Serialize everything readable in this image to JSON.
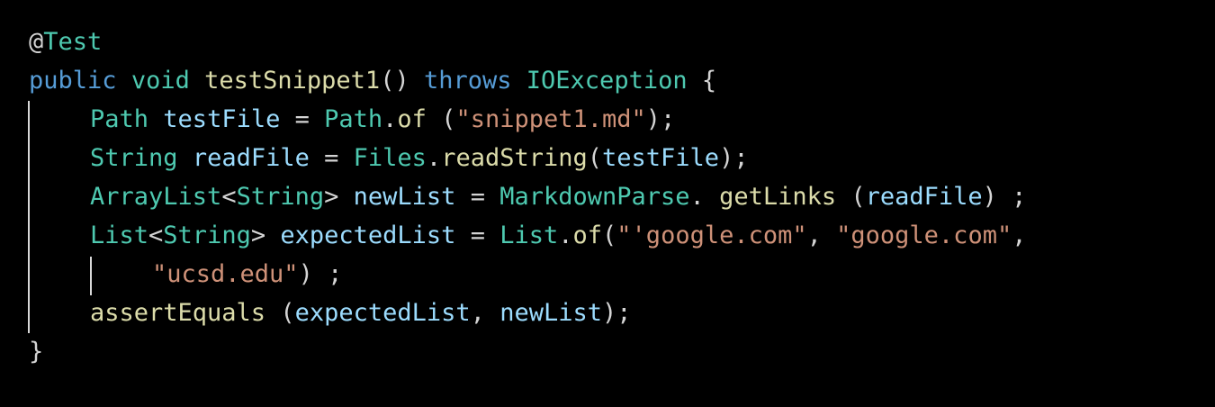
{
  "colors": {
    "background": "#000000",
    "keyword": "#569cd6",
    "type": "#4ec9b0",
    "function": "#dcdcaa",
    "variable": "#9cdcfe",
    "string": "#ce9178",
    "punctuation": "#d4d4d4",
    "indent_guide": "#d8d8d8"
  },
  "code": {
    "line1": {
      "at": "@",
      "annotation": "Test"
    },
    "line2": {
      "kw_public": "public",
      "kw_void": "void",
      "method_name": "testSnippet1",
      "parens": "() ",
      "kw_throws": "throws",
      "exception": "IOException",
      "brace": "{"
    },
    "line3": {
      "type": "Path",
      "var": "testFile",
      "op": " = ",
      "cls": "Path",
      "dot": ".",
      "method": "of",
      "open": " (",
      "str": "\"snippet1.md\"",
      "close": ");"
    },
    "line4": {
      "type": "String",
      "var": "readFile",
      "op": " = ",
      "cls": "Files",
      "dot": ".",
      "method": "readString",
      "open": "(",
      "arg": "testFile",
      "close": ");"
    },
    "line5": {
      "type": "ArrayList",
      "lt": "<",
      "generic": "String",
      "gt": "> ",
      "var": "newList",
      "op": " = ",
      "cls": "MarkdownParse",
      "dot": ". ",
      "method": "getLinks",
      "open": " (",
      "arg": "readFile",
      "close": ") ;"
    },
    "line6": {
      "type": "List",
      "lt": "<",
      "generic": "String",
      "gt": "> ",
      "var": "expectedList",
      "op": " = ",
      "cls": "List",
      "dot": ".",
      "method": "of",
      "open": "(",
      "str1": "\"'google.com\"",
      "sep": ", ",
      "str2": "\"google.com\"",
      "trail": ","
    },
    "line7": {
      "str": "\"ucsd.edu\"",
      "close": ") ;"
    },
    "line8": {
      "method": "assertEquals",
      "open": " (",
      "arg1": "expectedList",
      "sep": ", ",
      "arg2": "newList",
      "close": ");"
    },
    "line9": {
      "brace": "}"
    }
  }
}
